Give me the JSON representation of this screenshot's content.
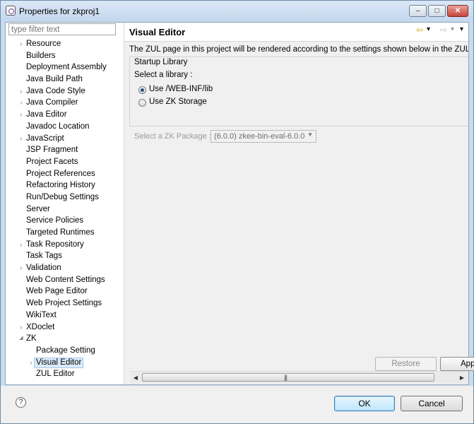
{
  "window": {
    "title": "Properties for zkproj1",
    "controls": {
      "minimize": "–",
      "maximize": "□",
      "close": "✕"
    }
  },
  "filter": {
    "placeholder": "type filter text"
  },
  "tree": {
    "items": [
      {
        "label": "Resource",
        "expandable": true,
        "depth": 0
      },
      {
        "label": "Builders",
        "expandable": false,
        "depth": 0
      },
      {
        "label": "Deployment Assembly",
        "expandable": false,
        "depth": 0
      },
      {
        "label": "Java Build Path",
        "expandable": false,
        "depth": 0
      },
      {
        "label": "Java Code Style",
        "expandable": true,
        "depth": 0
      },
      {
        "label": "Java Compiler",
        "expandable": true,
        "depth": 0
      },
      {
        "label": "Java Editor",
        "expandable": true,
        "depth": 0
      },
      {
        "label": "Javadoc Location",
        "expandable": false,
        "depth": 0
      },
      {
        "label": "JavaScript",
        "expandable": true,
        "depth": 0
      },
      {
        "label": "JSP Fragment",
        "expandable": false,
        "depth": 0
      },
      {
        "label": "Project Facets",
        "expandable": false,
        "depth": 0
      },
      {
        "label": "Project References",
        "expandable": false,
        "depth": 0
      },
      {
        "label": "Refactoring History",
        "expandable": false,
        "depth": 0
      },
      {
        "label": "Run/Debug Settings",
        "expandable": false,
        "depth": 0
      },
      {
        "label": "Server",
        "expandable": false,
        "depth": 0
      },
      {
        "label": "Service Policies",
        "expandable": false,
        "depth": 0
      },
      {
        "label": "Targeted Runtimes",
        "expandable": false,
        "depth": 0
      },
      {
        "label": "Task Repository",
        "expandable": true,
        "depth": 0
      },
      {
        "label": "Task Tags",
        "expandable": false,
        "depth": 0
      },
      {
        "label": "Validation",
        "expandable": true,
        "depth": 0
      },
      {
        "label": "Web Content Settings",
        "expandable": false,
        "depth": 0
      },
      {
        "label": "Web Page Editor",
        "expandable": false,
        "depth": 0
      },
      {
        "label": "Web Project Settings",
        "expandable": false,
        "depth": 0
      },
      {
        "label": "WikiText",
        "expandable": false,
        "depth": 0
      },
      {
        "label": "XDoclet",
        "expandable": true,
        "depth": 0
      },
      {
        "label": "ZK",
        "expandable": true,
        "expanded": true,
        "depth": 0
      },
      {
        "label": "Package Setting",
        "expandable": false,
        "depth": 1
      },
      {
        "label": "Visual Editor",
        "expandable": true,
        "depth": 1,
        "selected": true
      },
      {
        "label": "ZUL Editor",
        "expandable": false,
        "depth": 1
      }
    ]
  },
  "page": {
    "title": "Visual Editor",
    "description": "The ZUL page in this project will be rendered according to the settings shown below in the ZUL Visual Editor.",
    "startup_group": {
      "title": "Startup Library",
      "select_label": "Select a library :",
      "options": [
        {
          "label": "Use /WEB-INF/lib",
          "checked": true
        },
        {
          "label": "Use ZK Storage",
          "checked": false
        }
      ],
      "package_label": "Select a ZK Package :",
      "package_value": "(6.0.0)  zkee-bin-eval-6.0.0"
    },
    "restore_defaults": "Restore Defaults",
    "apply": "Apply"
  },
  "nav": {
    "back": "⇦",
    "forward": "⇨",
    "dropdown": "▾"
  },
  "scrollbar": {
    "left": "◀",
    "right": "▶",
    "grip": "|||"
  },
  "footer": {
    "help": "?",
    "ok": "OK",
    "cancel": "Cancel"
  },
  "colors": {
    "accent": "#3c7fb1",
    "selection": "#dbeaf9",
    "back_arrow": "#d9a400"
  }
}
